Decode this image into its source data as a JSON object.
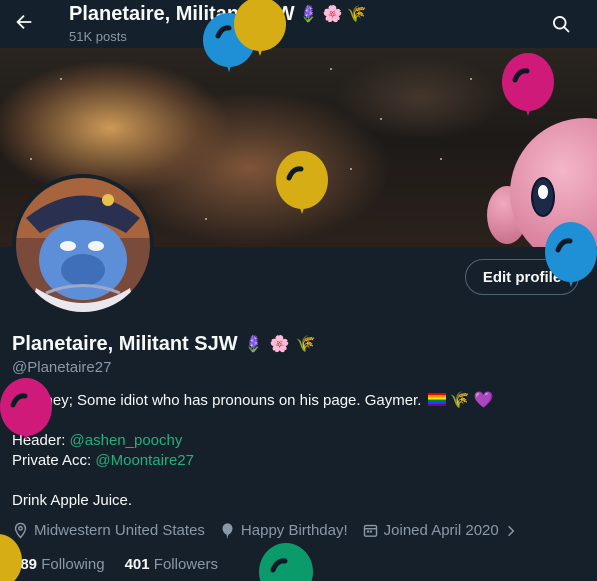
{
  "header": {
    "title": "Planetaire, Militant SJW",
    "title_emojis": [
      "🪻",
      "🌸",
      "🌾"
    ],
    "post_count": "51K posts"
  },
  "profile": {
    "display_name": "Planetaire, Militant SJW",
    "name_emojis": [
      "🪻",
      "🌸",
      "🌾"
    ],
    "handle": "@Planetaire27",
    "edit_button_label": "Edit profile",
    "bio": {
      "line1": "He/They; Some idiot who has pronouns on his page. Gaymer.",
      "line1_emojis": [
        "🌾",
        "💜"
      ],
      "header_label": "Header: ",
      "header_link": "@ashen_poochy",
      "private_label": "Private Acc: ",
      "private_link": "@Moontaire27",
      "line4": "Drink Apple Juice."
    },
    "meta": {
      "location": "Midwestern United States",
      "birthday": "Happy Birthday!",
      "joined": "Joined April 2020"
    },
    "stats": {
      "following_count": "389",
      "following_label": "Following",
      "followers_count": "401",
      "followers_label": "Followers"
    }
  },
  "colors": {
    "background": "#15202b",
    "text_secondary": "#8b98a5",
    "link": "#22b07d",
    "balloon_blue": "#1f8fd6",
    "balloon_yellow": "#d6ad14",
    "balloon_magenta": "#d01a7a",
    "balloon_green": "#0b9a6a"
  },
  "icons": {
    "back": "arrow-left-icon",
    "search": "search-icon",
    "location": "location-pin-icon",
    "birthday": "balloon-icon",
    "joined": "calendar-icon",
    "more": "chevron-right-icon"
  }
}
